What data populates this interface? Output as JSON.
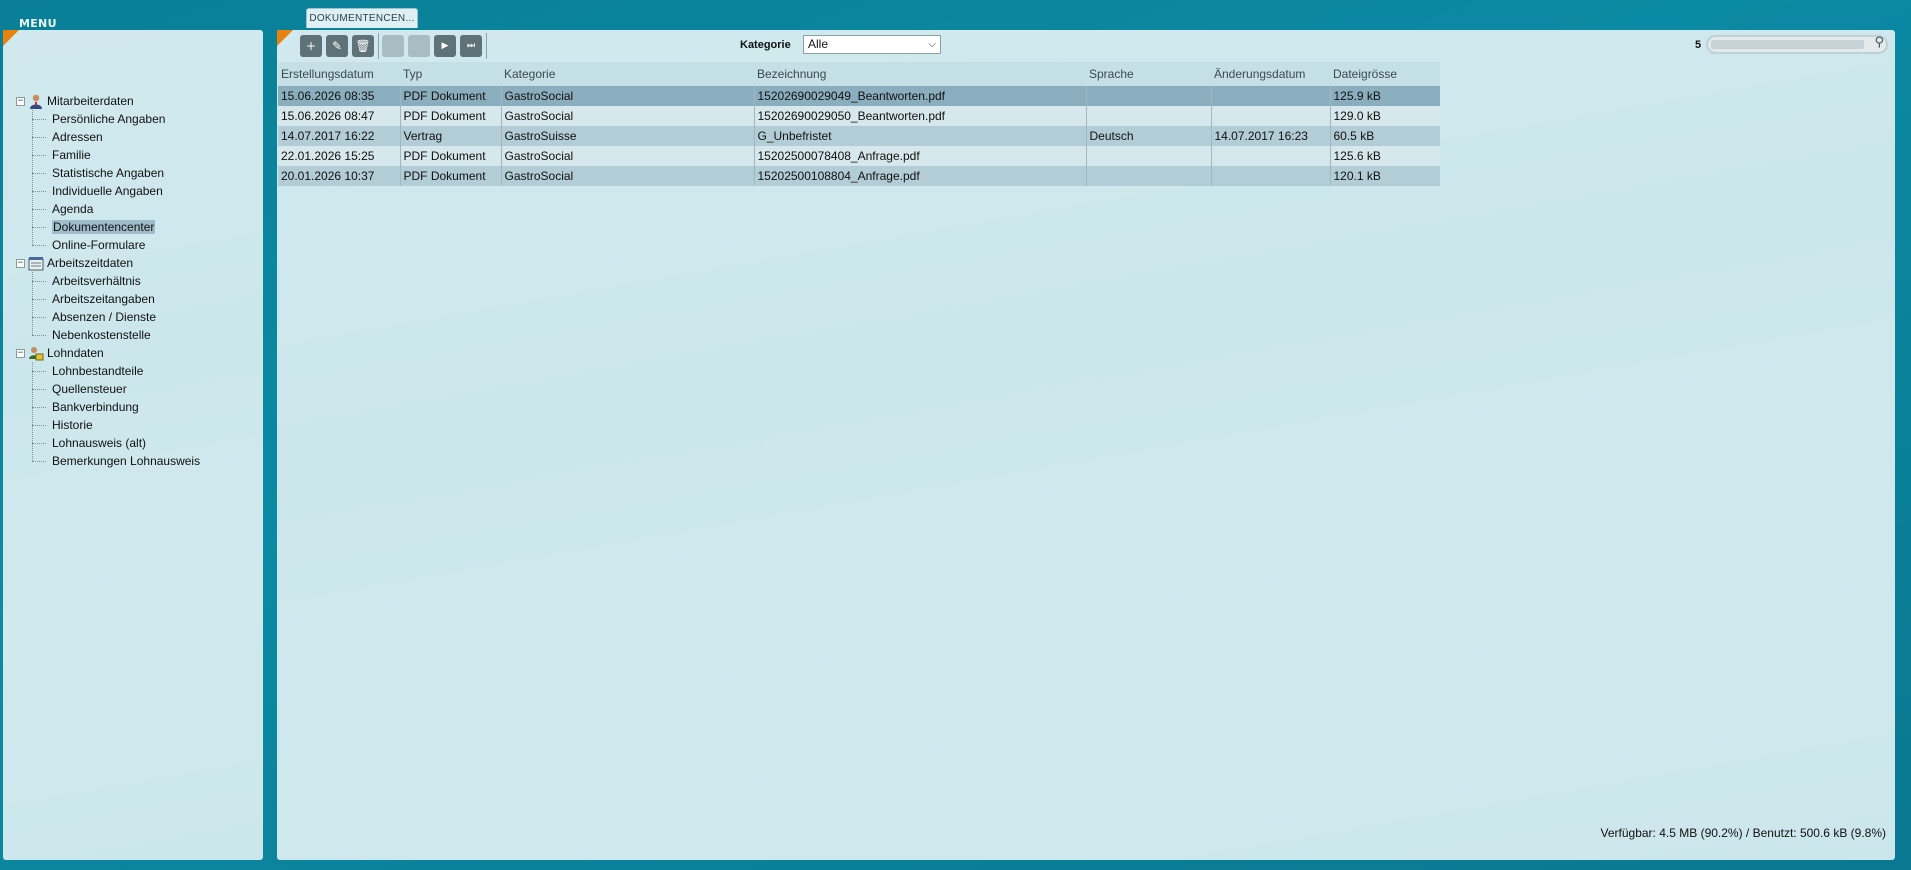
{
  "menu": {
    "title": "MENU"
  },
  "tab": {
    "label": "DOKUMENTENCEN..."
  },
  "tree": [
    {
      "label": "Mitarbeiterdaten",
      "icon": "person-icon",
      "items": [
        "Persönliche Angaben",
        "Adressen",
        "Familie",
        "Statistische Angaben",
        "Individuelle Angaben",
        "Agenda",
        "Dokumentencenter",
        "Online-Formulare"
      ]
    },
    {
      "label": "Arbeitszeitdaten",
      "icon": "timesheet-icon",
      "items": [
        "Arbeitsverhältnis",
        "Arbeitszeitangaben",
        "Absenzen / Dienste",
        "Nebenkostenstelle"
      ]
    },
    {
      "label": "Lohndaten",
      "icon": "salary-icon",
      "items": [
        "Lohnbestandteile",
        "Quellensteuer",
        "Bankverbindung",
        "Historie",
        "Lohnausweis (alt)",
        "Bemerkungen Lohnausweis"
      ]
    }
  ],
  "selected_item": "Dokumentencenter",
  "toolbar": {
    "buttons": [
      {
        "name": "add-button",
        "icon": "plus-icon",
        "glyph": "+"
      },
      {
        "name": "edit-button",
        "icon": "pencil-icon",
        "glyph": "✎"
      },
      {
        "name": "delete-button",
        "icon": "trash-icon",
        "glyph": "🗑"
      }
    ],
    "nav": [
      {
        "name": "first-page-button",
        "glyph": "",
        "disabled": true
      },
      {
        "name": "prev-page-button",
        "glyph": "",
        "disabled": true
      },
      {
        "name": "next-page-button",
        "glyph": "▶",
        "disabled": false
      },
      {
        "name": "last-page-button",
        "glyph": "⏭",
        "disabled": false
      }
    ]
  },
  "filter": {
    "label": "Kategorie",
    "value": "Alle"
  },
  "search": {
    "count": "5"
  },
  "table": {
    "columns": [
      "Erstellungsdatum",
      "Typ",
      "Kategorie",
      "Bezeichnung",
      "Sprache",
      "Änderungsdatum",
      "Dateigrösse"
    ],
    "rows": [
      [
        "15.06.2026 08:35",
        "PDF Dokument",
        "GastroSocial",
        "15202690029049_Beantworten.pdf",
        "",
        "",
        "125.9 kB"
      ],
      [
        "15.06.2026 08:47",
        "PDF Dokument",
        "GastroSocial",
        "15202690029050_Beantworten.pdf",
        "",
        "",
        "129.0 kB"
      ],
      [
        "14.07.2017 16:22",
        "Vertrag",
        "GastroSuisse",
        "G_Unbefristet",
        "Deutsch",
        "14.07.2017 16:23",
        "60.5 kB"
      ],
      [
        "22.01.2026 15:25",
        "PDF Dokument",
        "GastroSocial",
        "15202500078408_Anfrage.pdf",
        "",
        "",
        "125.6 kB"
      ],
      [
        "20.01.2026 10:37",
        "PDF Dokument",
        "GastroSocial",
        "15202500108804_Anfrage.pdf",
        "",
        "",
        "120.1 kB"
      ]
    ],
    "selected_row": 0
  },
  "footer": {
    "storage": "Verfügbar: 4.5 MB (90.2%) / Benutzt: 500.6 kB (9.8%)"
  },
  "colors": {
    "background": "#0a7f97",
    "panel": "#cce7ec",
    "accent": "#e8820f",
    "selected_row": "#8aaebd"
  }
}
